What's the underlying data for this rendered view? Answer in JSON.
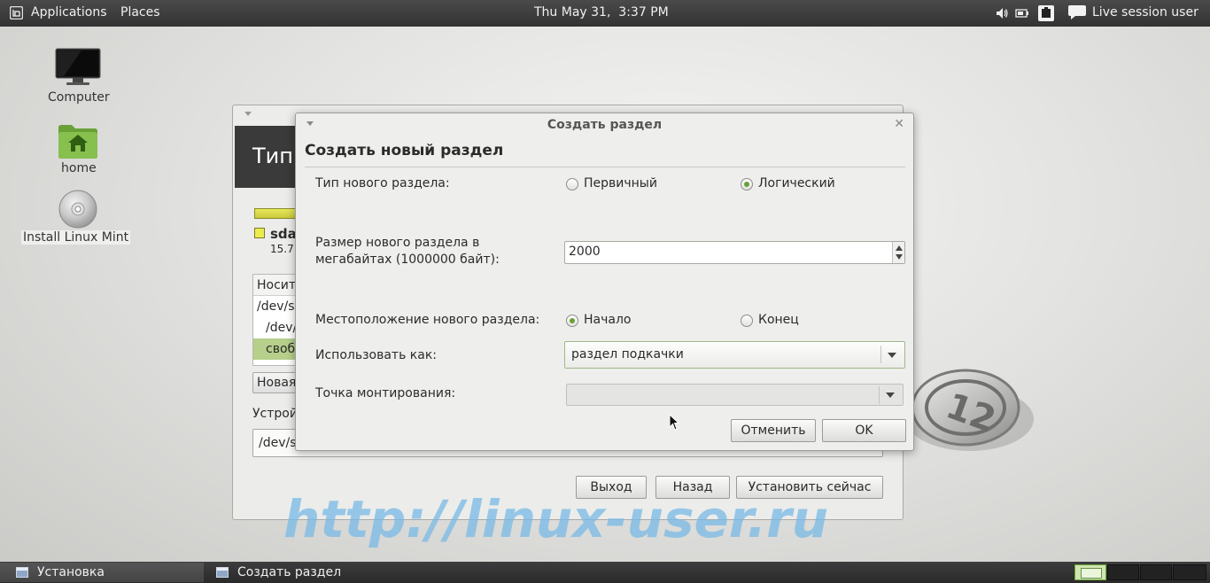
{
  "top_panel": {
    "menu_applications": "Applications",
    "menu_places": "Places",
    "clock": "Thu May 31,  3:37 PM",
    "user": "Live session user",
    "tray_icons": [
      "volume-icon",
      "battery-icon",
      "network-icon",
      "chat-icon"
    ]
  },
  "desktop": {
    "icons": [
      {
        "label": "Computer",
        "icon": "computer-icon"
      },
      {
        "label": "home",
        "icon": "home-folder-icon"
      },
      {
        "label": "Install Linux Mint",
        "icon": "disc-icon"
      }
    ]
  },
  "installer": {
    "header_title": "Тип",
    "disk_label": "sda",
    "disk_size": "15.7",
    "table": {
      "header": "Носит",
      "rows": [
        "/dev/s",
        "/dev/",
        "своб"
      ]
    },
    "new_button": "Новая",
    "device_label": "Устрой",
    "device_value": "/dev/s",
    "buttons": {
      "quit": "Выход",
      "back": "Назад",
      "install": "Установить сейчас"
    }
  },
  "dialog": {
    "title": "Создать раздел",
    "heading": "Создать новый раздел",
    "type_label": "Тип нового раздела:",
    "type_primary": "Первичный",
    "type_logical": "Логический",
    "type_selected": "Логический",
    "size_label_line1": "Размер нового раздела в",
    "size_label_line2": "мегабайтах (1000000 байт):",
    "size_value": "2000",
    "location_label": "Местоположение нового раздела:",
    "location_start": "Начало",
    "location_end": "Конец",
    "location_selected": "Начало",
    "use_as_label": "Использовать как:",
    "use_as_value": "раздел подкачки",
    "mount_label": "Точка монтирования:",
    "mount_value": "",
    "cancel_button": "Отменить",
    "ok_button": "OK"
  },
  "watermark": "http://linux-user.ru",
  "taskbar": {
    "tasks": [
      {
        "label": "Установка",
        "active": true
      },
      {
        "label": "Создать раздел",
        "active": false
      }
    ],
    "workspaces": 4,
    "active_workspace": 1
  },
  "colors": {
    "accent": "#6aa136",
    "panel": "#3a3a3a",
    "watermark": "#78b9e6"
  }
}
